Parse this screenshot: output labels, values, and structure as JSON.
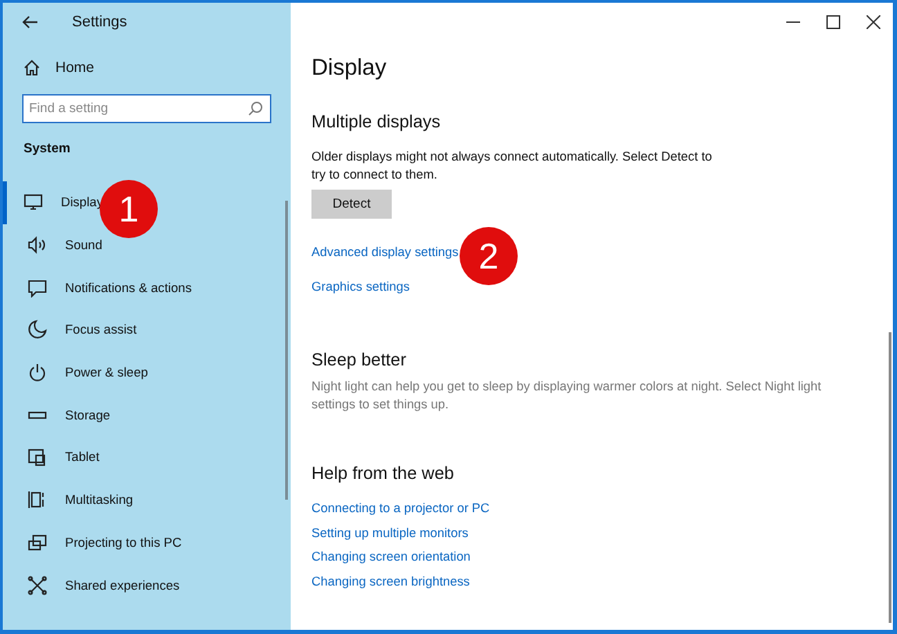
{
  "window": {
    "title": "Settings"
  },
  "sidebar": {
    "home": "Home",
    "search": {
      "placeholder": "Find a setting"
    },
    "section": "System",
    "items": [
      {
        "label": "Display",
        "selected": true
      },
      {
        "label": "Sound",
        "selected": false
      },
      {
        "label": "Notifications & actions",
        "selected": false
      },
      {
        "label": "Focus assist",
        "selected": false
      },
      {
        "label": "Power & sleep",
        "selected": false
      },
      {
        "label": "Storage",
        "selected": false
      },
      {
        "label": "Tablet",
        "selected": false
      },
      {
        "label": "Multitasking",
        "selected": false
      },
      {
        "label": "Projecting to this PC",
        "selected": false
      },
      {
        "label": "Shared experiences",
        "selected": false
      }
    ]
  },
  "page": {
    "title": "Display",
    "sections": [
      {
        "heading": "Multiple displays",
        "text": "Older displays might not always connect automatically. Select Detect to try to connect to them.",
        "muted": false,
        "button": "Detect",
        "links": [
          "Advanced display settings",
          "Graphics settings"
        ]
      },
      {
        "heading": "Sleep better",
        "text": "Night light can help you get to sleep by displaying warmer colors at night. Select Night light settings to set things up.",
        "muted": true
      },
      {
        "heading": "Help from the web",
        "links": [
          "Connecting to a projector or PC",
          "Setting up multiple monitors",
          "Changing screen orientation",
          "Changing screen brightness"
        ],
        "compact": true
      }
    ]
  },
  "annotations": [
    {
      "label": "1"
    },
    {
      "label": "2"
    }
  ]
}
